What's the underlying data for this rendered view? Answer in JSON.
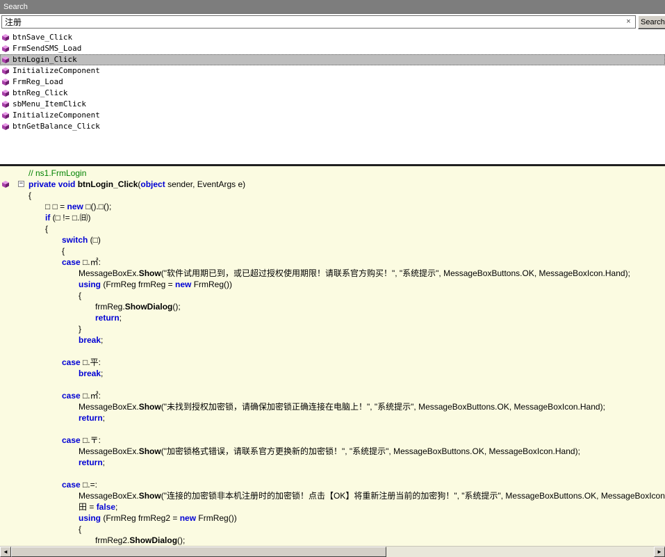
{
  "window": {
    "title": "Search"
  },
  "search": {
    "query": "注册",
    "clear_glyph": "×",
    "button_label": "Search"
  },
  "colors": {
    "titlebar": "#7d7d7d",
    "selection": "#bdbdbd",
    "code_background": "#fbfbe1",
    "keyword": "#0000d4",
    "comment": "#008200",
    "method_icon": "#a83fa8"
  },
  "results": {
    "icon": "method-cube-icon",
    "items": [
      {
        "label": "btnSave_Click",
        "selected": false
      },
      {
        "label": "FrmSendSMS_Load",
        "selected": false
      },
      {
        "label": "btnLogin_Click",
        "selected": true
      },
      {
        "label": "InitializeComponent",
        "selected": false
      },
      {
        "label": "FrmReg_Load",
        "selected": false
      },
      {
        "label": "btnReg_Click",
        "selected": false
      },
      {
        "label": "sbMenu_ItemClick",
        "selected": false
      },
      {
        "label": "InitializeComponent",
        "selected": false
      },
      {
        "label": "btnGetBalance_Click",
        "selected": false
      }
    ]
  },
  "code": {
    "fold_glyph": "−",
    "scroll_left_glyph": "◄",
    "scroll_right_glyph": "►",
    "lines": [
      {
        "ind": 0,
        "t": [
          [
            "c",
            "// ns1.FrmLogin"
          ]
        ]
      },
      {
        "ind": 0,
        "fold": true,
        "icon": true,
        "t": [
          [
            "k",
            "private"
          ],
          [
            "p",
            " "
          ],
          [
            "k",
            "void"
          ],
          [
            "p",
            " "
          ],
          [
            "m",
            "btnLogin_Click"
          ],
          [
            "p",
            "("
          ],
          [
            "k",
            "object"
          ],
          [
            "p",
            " sender, EventArgs e)"
          ]
        ]
      },
      {
        "ind": 0,
        "t": [
          [
            "p",
            "{"
          ]
        ]
      },
      {
        "ind": 1,
        "t": [
          [
            "p",
            "□ □ = "
          ],
          [
            "k",
            "new"
          ],
          [
            "p",
            " □().□();"
          ]
        ]
      },
      {
        "ind": 1,
        "t": [
          [
            "k",
            "if"
          ],
          [
            "p",
            " (□ != □.㈰)"
          ]
        ]
      },
      {
        "ind": 1,
        "t": [
          [
            "p",
            "{"
          ]
        ]
      },
      {
        "ind": 2,
        "t": [
          [
            "k",
            "switch"
          ],
          [
            "p",
            " (□)"
          ]
        ]
      },
      {
        "ind": 2,
        "t": [
          [
            "p",
            "{"
          ]
        ]
      },
      {
        "ind": 2,
        "t": [
          [
            "k",
            "case"
          ],
          [
            "p",
            " □.㎡:"
          ]
        ]
      },
      {
        "ind": 3,
        "t": [
          [
            "p",
            "MessageBoxEx."
          ],
          [
            "m",
            "Show"
          ],
          [
            "p",
            "(\"软件试用期已到，或已超过授权使用期限！请联系官方购买！\", \"系统提示\", MessageBoxButtons.OK, MessageBoxIcon.Hand);"
          ]
        ]
      },
      {
        "ind": 3,
        "t": [
          [
            "k",
            "using"
          ],
          [
            "p",
            " (FrmReg frmReg = "
          ],
          [
            "k",
            "new"
          ],
          [
            "p",
            " FrmReg())"
          ]
        ]
      },
      {
        "ind": 3,
        "t": [
          [
            "p",
            "{"
          ]
        ]
      },
      {
        "ind": 4,
        "t": [
          [
            "p",
            "frmReg."
          ],
          [
            "m",
            "ShowDialog"
          ],
          [
            "p",
            "();"
          ]
        ]
      },
      {
        "ind": 4,
        "t": [
          [
            "k",
            "return"
          ],
          [
            "p",
            ";"
          ]
        ]
      },
      {
        "ind": 3,
        "t": [
          [
            "p",
            "}"
          ]
        ]
      },
      {
        "ind": 3,
        "t": [
          [
            "k",
            "break"
          ],
          [
            "p",
            ";"
          ]
        ]
      },
      {
        "ind": 0,
        "t": []
      },
      {
        "ind": 2,
        "t": [
          [
            "k",
            "case"
          ],
          [
            "p",
            " □.平:"
          ]
        ]
      },
      {
        "ind": 3,
        "t": [
          [
            "k",
            "break"
          ],
          [
            "p",
            ";"
          ]
        ]
      },
      {
        "ind": 0,
        "t": []
      },
      {
        "ind": 2,
        "t": [
          [
            "k",
            "case"
          ],
          [
            "p",
            " □.㎡:"
          ]
        ]
      },
      {
        "ind": 3,
        "t": [
          [
            "p",
            "MessageBoxEx."
          ],
          [
            "m",
            "Show"
          ],
          [
            "p",
            "(\"未找到授权加密锁，请确保加密锁正确连接在电脑上！\", \"系统提示\", MessageBoxButtons.OK, MessageBoxIcon.Hand);"
          ]
        ]
      },
      {
        "ind": 3,
        "t": [
          [
            "k",
            "return"
          ],
          [
            "p",
            ";"
          ]
        ]
      },
      {
        "ind": 0,
        "t": []
      },
      {
        "ind": 2,
        "t": [
          [
            "k",
            "case"
          ],
          [
            "p",
            " □.〒:"
          ]
        ]
      },
      {
        "ind": 3,
        "t": [
          [
            "p",
            "MessageBoxEx."
          ],
          [
            "m",
            "Show"
          ],
          [
            "p",
            "(\"加密锁格式错误，请联系官方更换新的加密锁！\", \"系统提示\", MessageBoxButtons.OK, MessageBoxIcon.Hand);"
          ]
        ]
      },
      {
        "ind": 3,
        "t": [
          [
            "k",
            "return"
          ],
          [
            "p",
            ";"
          ]
        ]
      },
      {
        "ind": 0,
        "t": []
      },
      {
        "ind": 2,
        "t": [
          [
            "k",
            "case"
          ],
          [
            "p",
            " □.=:"
          ]
        ]
      },
      {
        "ind": 3,
        "t": [
          [
            "p",
            "MessageBoxEx."
          ],
          [
            "m",
            "Show"
          ],
          [
            "p",
            "(\"连接的加密锁非本机注册时的加密锁！点击【OK】将重新注册当前的加密狗！\", \"系统提示\", MessageBoxButtons.OK, MessageBoxIcon.Hand);"
          ]
        ]
      },
      {
        "ind": 3,
        "t": [
          [
            "p",
            "田 = "
          ],
          [
            "k",
            "false"
          ],
          [
            "p",
            ";"
          ]
        ]
      },
      {
        "ind": 3,
        "t": [
          [
            "k",
            "using"
          ],
          [
            "p",
            " (FrmReg frmReg2 = "
          ],
          [
            "k",
            "new"
          ],
          [
            "p",
            " FrmReg())"
          ]
        ]
      },
      {
        "ind": 3,
        "t": [
          [
            "p",
            "{"
          ]
        ]
      },
      {
        "ind": 4,
        "t": [
          [
            "p",
            "frmReg2."
          ],
          [
            "m",
            "ShowDialog"
          ],
          [
            "p",
            "();"
          ]
        ]
      }
    ]
  }
}
